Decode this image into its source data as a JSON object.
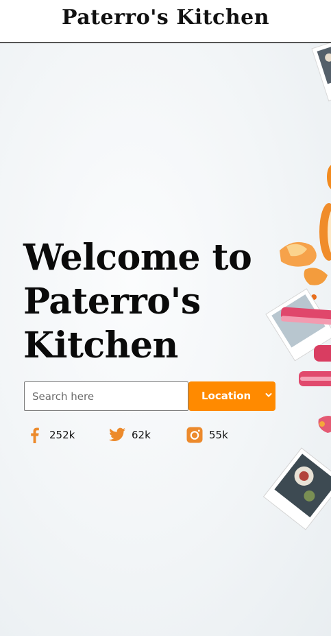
{
  "header": {
    "title": "Paterro's Kitchen"
  },
  "hero": {
    "headline_lines": [
      "Welcome to",
      "Paterro's",
      "Kitchen"
    ]
  },
  "search": {
    "placeholder": "Search here",
    "value": ""
  },
  "location": {
    "label": "Location",
    "icon": "chevron-down-icon"
  },
  "socials": [
    {
      "network": "facebook",
      "icon": "facebook-icon",
      "count": "252k"
    },
    {
      "network": "twitter",
      "icon": "twitter-icon",
      "count": "62k"
    },
    {
      "network": "instagram",
      "icon": "instagram-icon",
      "count": "55k"
    }
  ],
  "colors": {
    "accent": "#ff8a00",
    "icon": "#ec8a2c",
    "text": "#111111",
    "header_border": "#555555"
  }
}
